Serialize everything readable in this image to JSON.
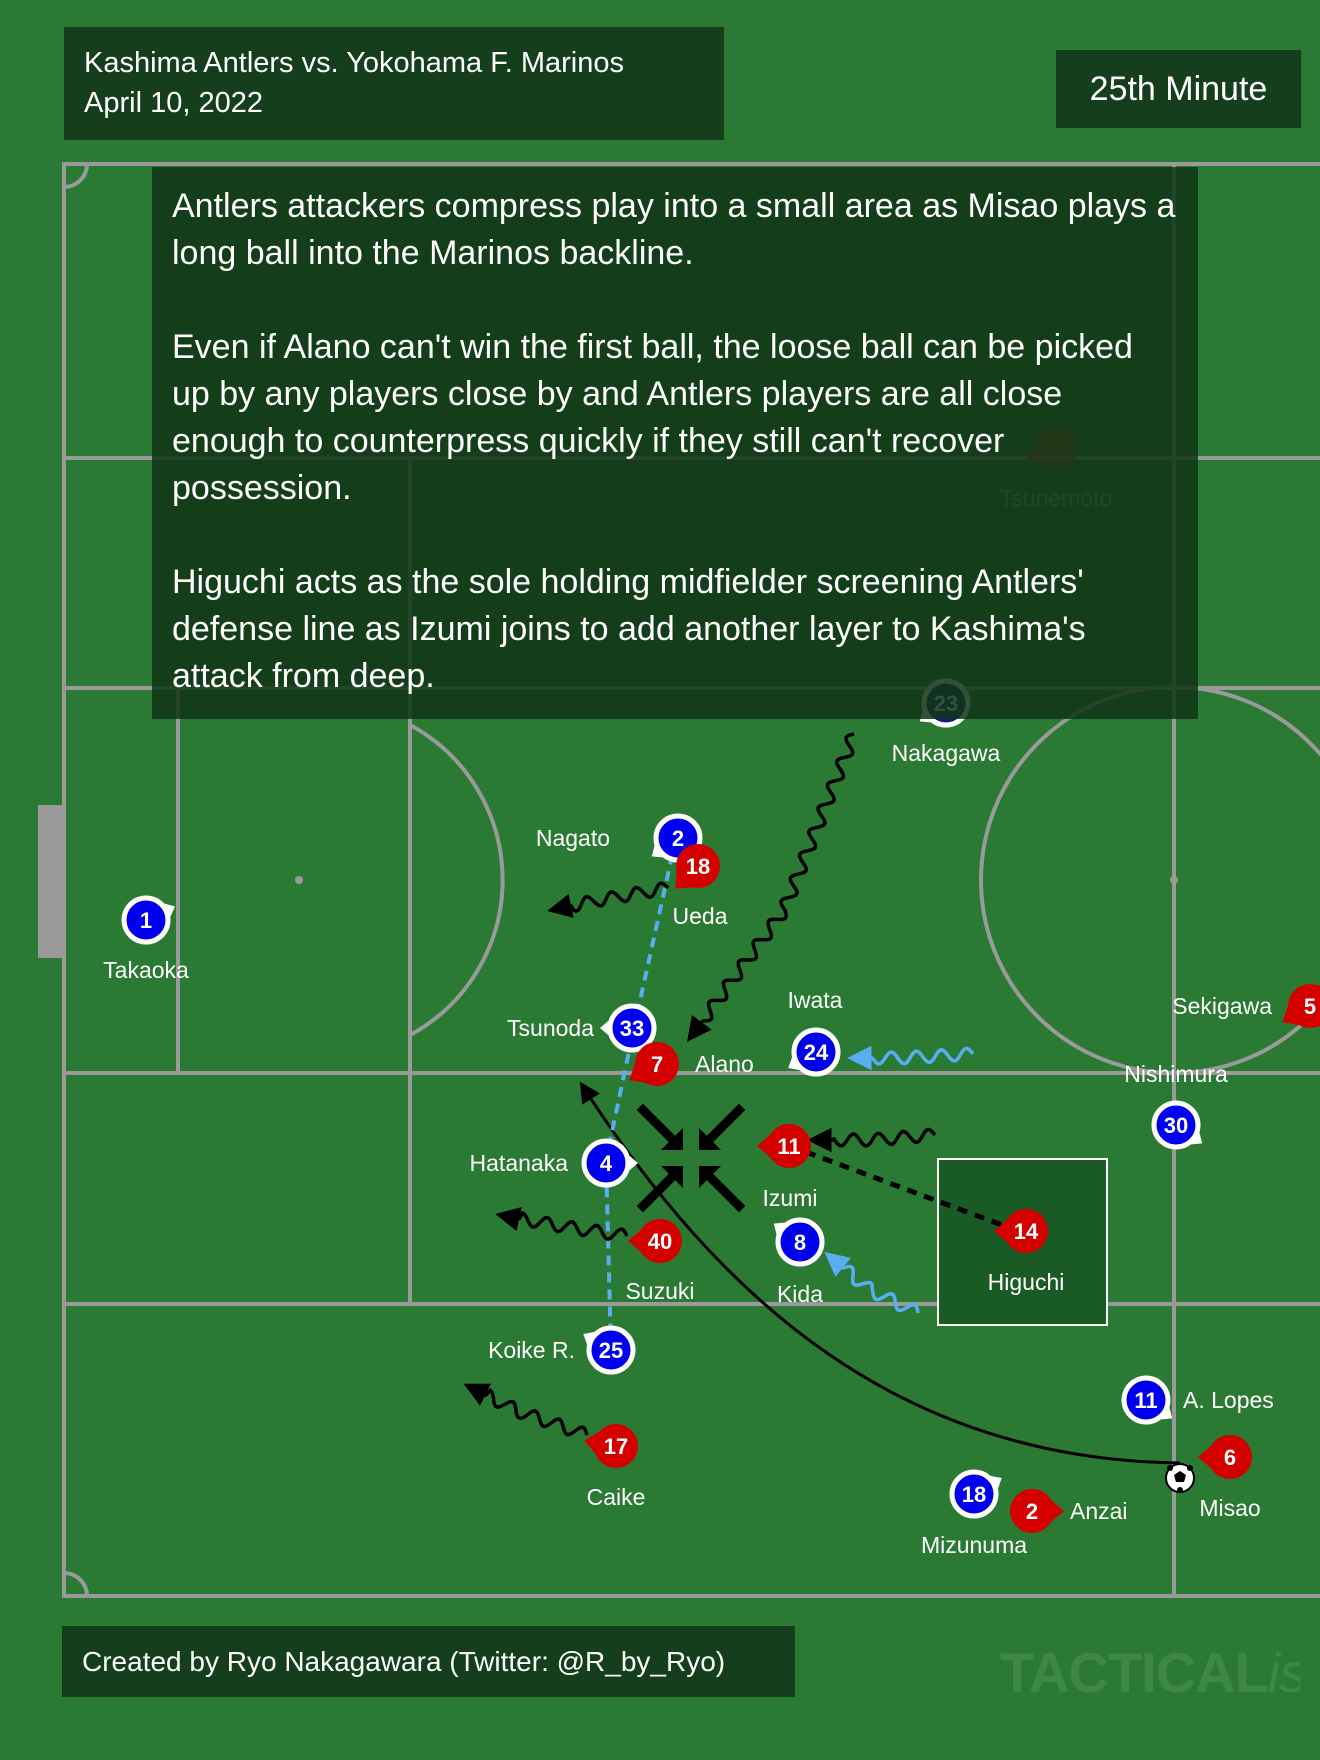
{
  "header": {
    "match": "Kashima Antlers vs. Yokohama F. Marinos",
    "date": "April 10, 2022",
    "minute": "25th Minute"
  },
  "notes": [
    "Antlers attackers compress play into a small area as Misao plays a long ball into the Marinos backline.",
    "Even if Alano can't win the first ball, the loose ball can be picked up by any players close by and Antlers players are all close enough to counterpress quickly if they still can't recover possession.",
    "Higuchi acts as the sole holding midfielder screening Antlers' defense line as Izumi joins to add another layer to Kashima's attack from deep."
  ],
  "footer": {
    "credit": "Created by Ryo Nakagawara (Twitter: @R_by_Ryo)",
    "watermark_main": "TACTICAL",
    "watermark_tail": "ista"
  },
  "colors": {
    "pitch": "#2a7a34",
    "line": "#9a9a9a",
    "antlers": "#d40000",
    "marinos": "#0000ee",
    "marinos_dark": "#10207a",
    "arrow_black": "#000000",
    "arrow_blue": "#5aaef0"
  },
  "players": {
    "marinos": [
      {
        "number": "1",
        "name": "Takaoka"
      },
      {
        "number": "2",
        "name": "Nagato"
      },
      {
        "number": "33",
        "name": "Tsunoda"
      },
      {
        "number": "4",
        "name": "Hatanaka"
      },
      {
        "number": "25",
        "name": "Koike R."
      },
      {
        "number": "24",
        "name": "Iwata"
      },
      {
        "number": "8",
        "name": "Kida"
      },
      {
        "number": "30",
        "name": "Nishimura"
      },
      {
        "number": "11",
        "name": "A. Lopes"
      },
      {
        "number": "18",
        "name": "Mizunuma"
      },
      {
        "number": "23",
        "name": "Nakagawa"
      }
    ],
    "antlers": [
      {
        "number": "18",
        "name": "Ueda"
      },
      {
        "number": "7",
        "name": "Alano"
      },
      {
        "number": "11",
        "name": "Izumi"
      },
      {
        "number": "40",
        "name": "Suzuki"
      },
      {
        "number": "17",
        "name": "Caike"
      },
      {
        "number": "14",
        "name": "Higuchi"
      },
      {
        "number": "6",
        "name": "Misao"
      },
      {
        "number": "2",
        "name": "Anzai"
      },
      {
        "number": "5",
        "name": "Sekigawa"
      },
      {
        "number": "",
        "name": "Tsunemoto"
      }
    ]
  }
}
